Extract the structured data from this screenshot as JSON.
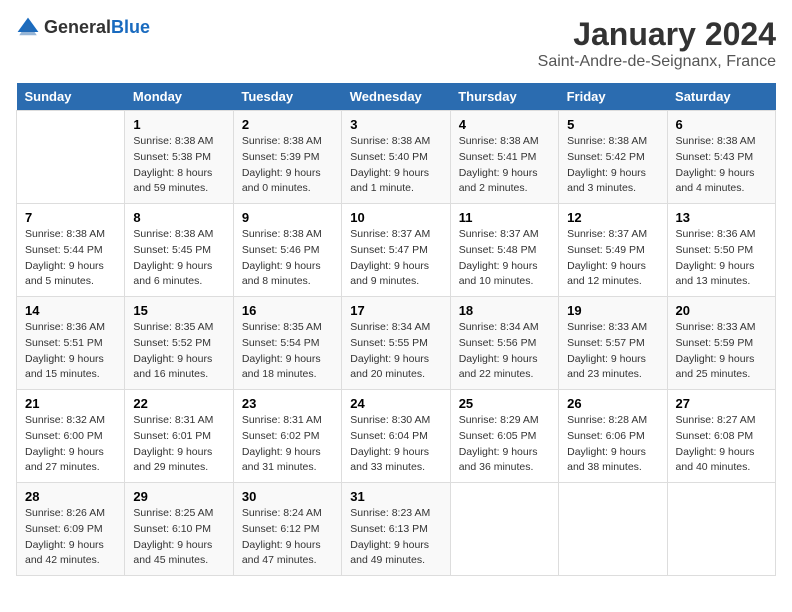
{
  "logo": {
    "general": "General",
    "blue": "Blue"
  },
  "title": "January 2024",
  "subtitle": "Saint-Andre-de-Seignanx, France",
  "days_of_week": [
    "Sunday",
    "Monday",
    "Tuesday",
    "Wednesday",
    "Thursday",
    "Friday",
    "Saturday"
  ],
  "weeks": [
    [
      {
        "day": "",
        "sunrise": "",
        "sunset": "",
        "daylight": ""
      },
      {
        "day": "1",
        "sunrise": "Sunrise: 8:38 AM",
        "sunset": "Sunset: 5:38 PM",
        "daylight": "Daylight: 8 hours and 59 minutes."
      },
      {
        "day": "2",
        "sunrise": "Sunrise: 8:38 AM",
        "sunset": "Sunset: 5:39 PM",
        "daylight": "Daylight: 9 hours and 0 minutes."
      },
      {
        "day": "3",
        "sunrise": "Sunrise: 8:38 AM",
        "sunset": "Sunset: 5:40 PM",
        "daylight": "Daylight: 9 hours and 1 minute."
      },
      {
        "day": "4",
        "sunrise": "Sunrise: 8:38 AM",
        "sunset": "Sunset: 5:41 PM",
        "daylight": "Daylight: 9 hours and 2 minutes."
      },
      {
        "day": "5",
        "sunrise": "Sunrise: 8:38 AM",
        "sunset": "Sunset: 5:42 PM",
        "daylight": "Daylight: 9 hours and 3 minutes."
      },
      {
        "day": "6",
        "sunrise": "Sunrise: 8:38 AM",
        "sunset": "Sunset: 5:43 PM",
        "daylight": "Daylight: 9 hours and 4 minutes."
      }
    ],
    [
      {
        "day": "7",
        "sunrise": "Sunrise: 8:38 AM",
        "sunset": "Sunset: 5:44 PM",
        "daylight": "Daylight: 9 hours and 5 minutes."
      },
      {
        "day": "8",
        "sunrise": "Sunrise: 8:38 AM",
        "sunset": "Sunset: 5:45 PM",
        "daylight": "Daylight: 9 hours and 6 minutes."
      },
      {
        "day": "9",
        "sunrise": "Sunrise: 8:38 AM",
        "sunset": "Sunset: 5:46 PM",
        "daylight": "Daylight: 9 hours and 8 minutes."
      },
      {
        "day": "10",
        "sunrise": "Sunrise: 8:37 AM",
        "sunset": "Sunset: 5:47 PM",
        "daylight": "Daylight: 9 hours and 9 minutes."
      },
      {
        "day": "11",
        "sunrise": "Sunrise: 8:37 AM",
        "sunset": "Sunset: 5:48 PM",
        "daylight": "Daylight: 9 hours and 10 minutes."
      },
      {
        "day": "12",
        "sunrise": "Sunrise: 8:37 AM",
        "sunset": "Sunset: 5:49 PM",
        "daylight": "Daylight: 9 hours and 12 minutes."
      },
      {
        "day": "13",
        "sunrise": "Sunrise: 8:36 AM",
        "sunset": "Sunset: 5:50 PM",
        "daylight": "Daylight: 9 hours and 13 minutes."
      }
    ],
    [
      {
        "day": "14",
        "sunrise": "Sunrise: 8:36 AM",
        "sunset": "Sunset: 5:51 PM",
        "daylight": "Daylight: 9 hours and 15 minutes."
      },
      {
        "day": "15",
        "sunrise": "Sunrise: 8:35 AM",
        "sunset": "Sunset: 5:52 PM",
        "daylight": "Daylight: 9 hours and 16 minutes."
      },
      {
        "day": "16",
        "sunrise": "Sunrise: 8:35 AM",
        "sunset": "Sunset: 5:54 PM",
        "daylight": "Daylight: 9 hours and 18 minutes."
      },
      {
        "day": "17",
        "sunrise": "Sunrise: 8:34 AM",
        "sunset": "Sunset: 5:55 PM",
        "daylight": "Daylight: 9 hours and 20 minutes."
      },
      {
        "day": "18",
        "sunrise": "Sunrise: 8:34 AM",
        "sunset": "Sunset: 5:56 PM",
        "daylight": "Daylight: 9 hours and 22 minutes."
      },
      {
        "day": "19",
        "sunrise": "Sunrise: 8:33 AM",
        "sunset": "Sunset: 5:57 PM",
        "daylight": "Daylight: 9 hours and 23 minutes."
      },
      {
        "day": "20",
        "sunrise": "Sunrise: 8:33 AM",
        "sunset": "Sunset: 5:59 PM",
        "daylight": "Daylight: 9 hours and 25 minutes."
      }
    ],
    [
      {
        "day": "21",
        "sunrise": "Sunrise: 8:32 AM",
        "sunset": "Sunset: 6:00 PM",
        "daylight": "Daylight: 9 hours and 27 minutes."
      },
      {
        "day": "22",
        "sunrise": "Sunrise: 8:31 AM",
        "sunset": "Sunset: 6:01 PM",
        "daylight": "Daylight: 9 hours and 29 minutes."
      },
      {
        "day": "23",
        "sunrise": "Sunrise: 8:31 AM",
        "sunset": "Sunset: 6:02 PM",
        "daylight": "Daylight: 9 hours and 31 minutes."
      },
      {
        "day": "24",
        "sunrise": "Sunrise: 8:30 AM",
        "sunset": "Sunset: 6:04 PM",
        "daylight": "Daylight: 9 hours and 33 minutes."
      },
      {
        "day": "25",
        "sunrise": "Sunrise: 8:29 AM",
        "sunset": "Sunset: 6:05 PM",
        "daylight": "Daylight: 9 hours and 36 minutes."
      },
      {
        "day": "26",
        "sunrise": "Sunrise: 8:28 AM",
        "sunset": "Sunset: 6:06 PM",
        "daylight": "Daylight: 9 hours and 38 minutes."
      },
      {
        "day": "27",
        "sunrise": "Sunrise: 8:27 AM",
        "sunset": "Sunset: 6:08 PM",
        "daylight": "Daylight: 9 hours and 40 minutes."
      }
    ],
    [
      {
        "day": "28",
        "sunrise": "Sunrise: 8:26 AM",
        "sunset": "Sunset: 6:09 PM",
        "daylight": "Daylight: 9 hours and 42 minutes."
      },
      {
        "day": "29",
        "sunrise": "Sunrise: 8:25 AM",
        "sunset": "Sunset: 6:10 PM",
        "daylight": "Daylight: 9 hours and 45 minutes."
      },
      {
        "day": "30",
        "sunrise": "Sunrise: 8:24 AM",
        "sunset": "Sunset: 6:12 PM",
        "daylight": "Daylight: 9 hours and 47 minutes."
      },
      {
        "day": "31",
        "sunrise": "Sunrise: 8:23 AM",
        "sunset": "Sunset: 6:13 PM",
        "daylight": "Daylight: 9 hours and 49 minutes."
      },
      {
        "day": "",
        "sunrise": "",
        "sunset": "",
        "daylight": ""
      },
      {
        "day": "",
        "sunrise": "",
        "sunset": "",
        "daylight": ""
      },
      {
        "day": "",
        "sunrise": "",
        "sunset": "",
        "daylight": ""
      }
    ]
  ]
}
